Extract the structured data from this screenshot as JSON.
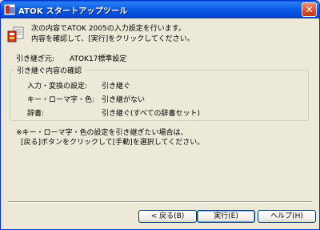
{
  "window": {
    "title": "ATOK スタートアップツール",
    "close_glyph": "✕"
  },
  "intro": {
    "line1": "次の内容でATOK 2005の入力設定を行います。",
    "line2": "内容を確認して、[実行]をクリックしてください。",
    "icon": "setup-settings-icon"
  },
  "source": {
    "label": "引き継ぎ元:",
    "value": "ATOK17標準設定"
  },
  "confirm_group": {
    "title": "引き継ぐ内容の確認",
    "rows": [
      {
        "label": "入力・変換の設定:",
        "value": "引き継ぐ"
      },
      {
        "label": "キー・ローマ字・色:",
        "value": "引き継がない"
      },
      {
        "label": "辞書:",
        "value": "引き継ぐ(すべての辞書セット)"
      }
    ]
  },
  "note": {
    "line1": "※キー・ローマ字・色の設定を引き継ぎたい場合は、",
    "line2": "[戻る]ボタンをクリックして[手動]を選択してください。"
  },
  "buttons": {
    "back": "< 戻る(B)",
    "execute": "実行(E)",
    "help": "ヘルプ(H)"
  },
  "colors": {
    "titlebar": "#0a5fe0",
    "dialog_bg": "#ece9d8",
    "close_button": "#d8512c"
  }
}
